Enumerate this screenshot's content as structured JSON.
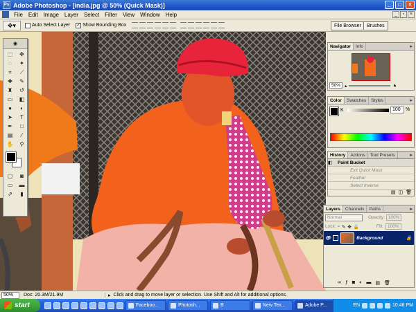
{
  "window": {
    "title": "Adobe Photoshop - [india.jpg @ 50% (Quick Mask)]",
    "controls": [
      "_",
      "□",
      "×"
    ]
  },
  "menu": [
    "File",
    "Edit",
    "Image",
    "Layer",
    "Select",
    "Filter",
    "View",
    "Window",
    "Help"
  ],
  "options": {
    "auto_select": "Auto Select Layer",
    "show_bbox": "Show Bounding Box",
    "tabs": [
      "File Browser",
      "Brushes"
    ]
  },
  "navigator": {
    "tabs": [
      "Navigator",
      "Info"
    ],
    "zoom": "50%"
  },
  "color": {
    "tabs": [
      "Color",
      "Swatches",
      "Styles"
    ],
    "channel": "K",
    "value": "100",
    "unit": "%"
  },
  "history": {
    "tabs": [
      "History",
      "Actions",
      "Tool Presets"
    ],
    "items": [
      "Paint Bucket",
      "Exit Quick Mask",
      "Feather",
      "Select Inverse"
    ]
  },
  "layers": {
    "tabs": [
      "Layers",
      "Channels",
      "Paths"
    ],
    "blend": "Normal",
    "opacity_label": "Opacity:",
    "opacity": "100%",
    "lock_label": "Lock:",
    "fill_label": "Fill:",
    "fill": "100%",
    "layer_name": "Background"
  },
  "status": {
    "zoom": "50%",
    "doc": "Doc: 20.3M/21.9M",
    "hint": "Click and drag to move layer or selection. Use Shift and Alt for additional options."
  },
  "taskbar": {
    "start": "start",
    "tasks": [
      "Faceboo...",
      "Photosh...",
      "B",
      "New Tex...",
      "Adobe P..."
    ],
    "lang": "EN",
    "clock": "10:48 PM"
  },
  "colors": {
    "xp_blue": "#245edb",
    "start_green": "#38a33a",
    "chrome": "#ece9d8"
  }
}
